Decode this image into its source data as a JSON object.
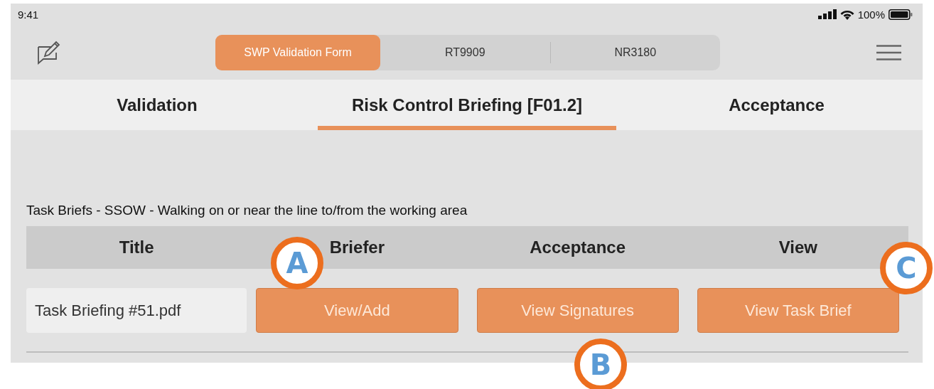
{
  "status_bar": {
    "time": "9:41",
    "battery": "100%"
  },
  "segments": [
    {
      "label": "SWP Validation Form",
      "selected": true
    },
    {
      "label": "RT9909",
      "selected": false
    },
    {
      "label": "NR3180",
      "selected": false
    }
  ],
  "tabs": [
    {
      "label": "Validation",
      "selected": false
    },
    {
      "label": "Risk Control Briefing [F01.2]",
      "selected": true
    },
    {
      "label": "Acceptance",
      "selected": false
    }
  ],
  "section_title": "Task Briefs - SSOW - Walking on or near the line to/from the working area",
  "table": {
    "columns": [
      "Title",
      "Briefer",
      "Acceptance",
      "View"
    ],
    "rows": [
      {
        "title": "Task Briefing #51.pdf",
        "buttons": [
          "View/Add",
          "View Signatures",
          "View Task Brief"
        ]
      }
    ]
  },
  "callouts": [
    "A",
    "B",
    "C"
  ]
}
